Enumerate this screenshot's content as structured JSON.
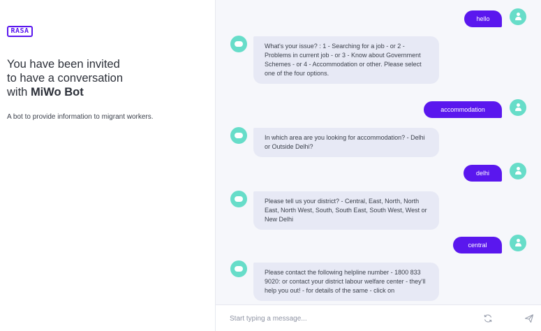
{
  "left": {
    "logo_text": "RASA",
    "invite_line1": "You have been invited",
    "invite_line2": "to have a conversation",
    "invite_prefix": "with ",
    "bot_name": "MiWo Bot",
    "description": "A bot to provide information to migrant workers."
  },
  "chat": {
    "messages": [
      {
        "sender": "user",
        "text": "hello"
      },
      {
        "sender": "bot",
        "text": "What's your issue? : 1 - Searching for a job - or 2 - Problems in current job - or 3 - Know about Government Schemes - or 4 - Accommodation or other. Please select one of the four options."
      },
      {
        "sender": "user",
        "text": "accommodation"
      },
      {
        "sender": "bot",
        "text": "In which area are you looking for accommodation? - Delhi or Outside Delhi?"
      },
      {
        "sender": "user",
        "text": "delhi"
      },
      {
        "sender": "bot",
        "text": "Please tell us your district? - Central, East, North, North East, North West, South, South East, South West, West or New Delhi"
      },
      {
        "sender": "user",
        "text": "central"
      },
      {
        "sender": "bot",
        "text": "Please contact the following helpline number - 1800 833 9020: or contact your district labour welfare center - they'll help you out! - for details of the same - click on"
      }
    ],
    "composer": {
      "placeholder": "Start typing a message..."
    }
  },
  "icons": {
    "user_avatar": "user-avatar-icon",
    "bot_avatar": "bot-avatar-icon",
    "refresh": "refresh-icon",
    "send": "send-icon"
  },
  "colors": {
    "brand": "#5a17ee",
    "avatar": "#67ddc9",
    "bot_bubble": "#e7e9f5",
    "chat_background": "#f6f7fb"
  }
}
